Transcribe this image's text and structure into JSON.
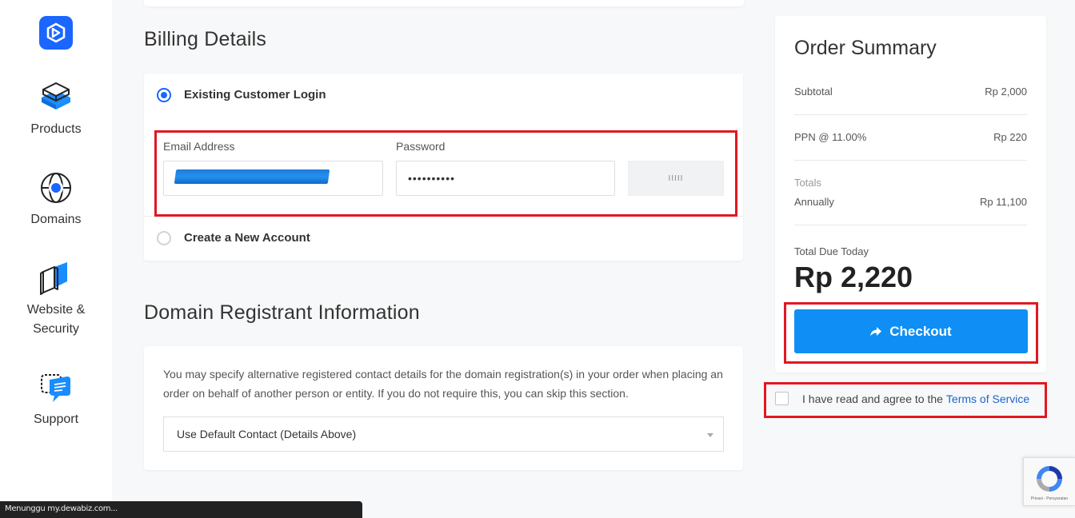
{
  "sidebar": {
    "items": [
      {
        "label": "Products",
        "icon": "box-stack-icon"
      },
      {
        "label": "Domains",
        "icon": "globe-icon"
      },
      {
        "label": "Website &\nSecurity",
        "icon": "shield-book-icon"
      },
      {
        "label": "Support",
        "icon": "chat-bubble-icon"
      }
    ]
  },
  "billing": {
    "title": "Billing Details",
    "existing_label": "Existing Customer Login",
    "email_label": "Email Address",
    "email_value": "",
    "password_label": "Password",
    "password_value": "••••••••••",
    "password_button": "IIIII",
    "new_account_label": "Create a New Account"
  },
  "registrant": {
    "title": "Domain Registrant Information",
    "description": "You may specify alternative registered contact details for the domain registration(s) in your order when placing an order on behalf of another person or entity. If you do not require this, you can skip this section.",
    "select_value": "Use Default Contact (Details Above)"
  },
  "summary": {
    "title": "Order Summary",
    "subtotal_label": "Subtotal",
    "subtotal_value": "Rp 2,000",
    "tax_label": "PPN @ 11.00%",
    "tax_value": "Rp 220",
    "totals_label": "Totals",
    "annually_label": "Annually",
    "annually_value": "Rp 11,100",
    "total_due_label": "Total Due Today",
    "total_due_value": "Rp 2,220",
    "checkout_label": "Checkout"
  },
  "tos": {
    "text": "I have read and agree to the",
    "link": "Terms of Service"
  },
  "status_bar": "Menunggu my.dewabiz.com...",
  "recaptcha_text": "Privasi - Persyaratan",
  "colors": {
    "accent": "#1a66ff",
    "checkout": "#0f8ff5",
    "highlight": "#e01822"
  }
}
